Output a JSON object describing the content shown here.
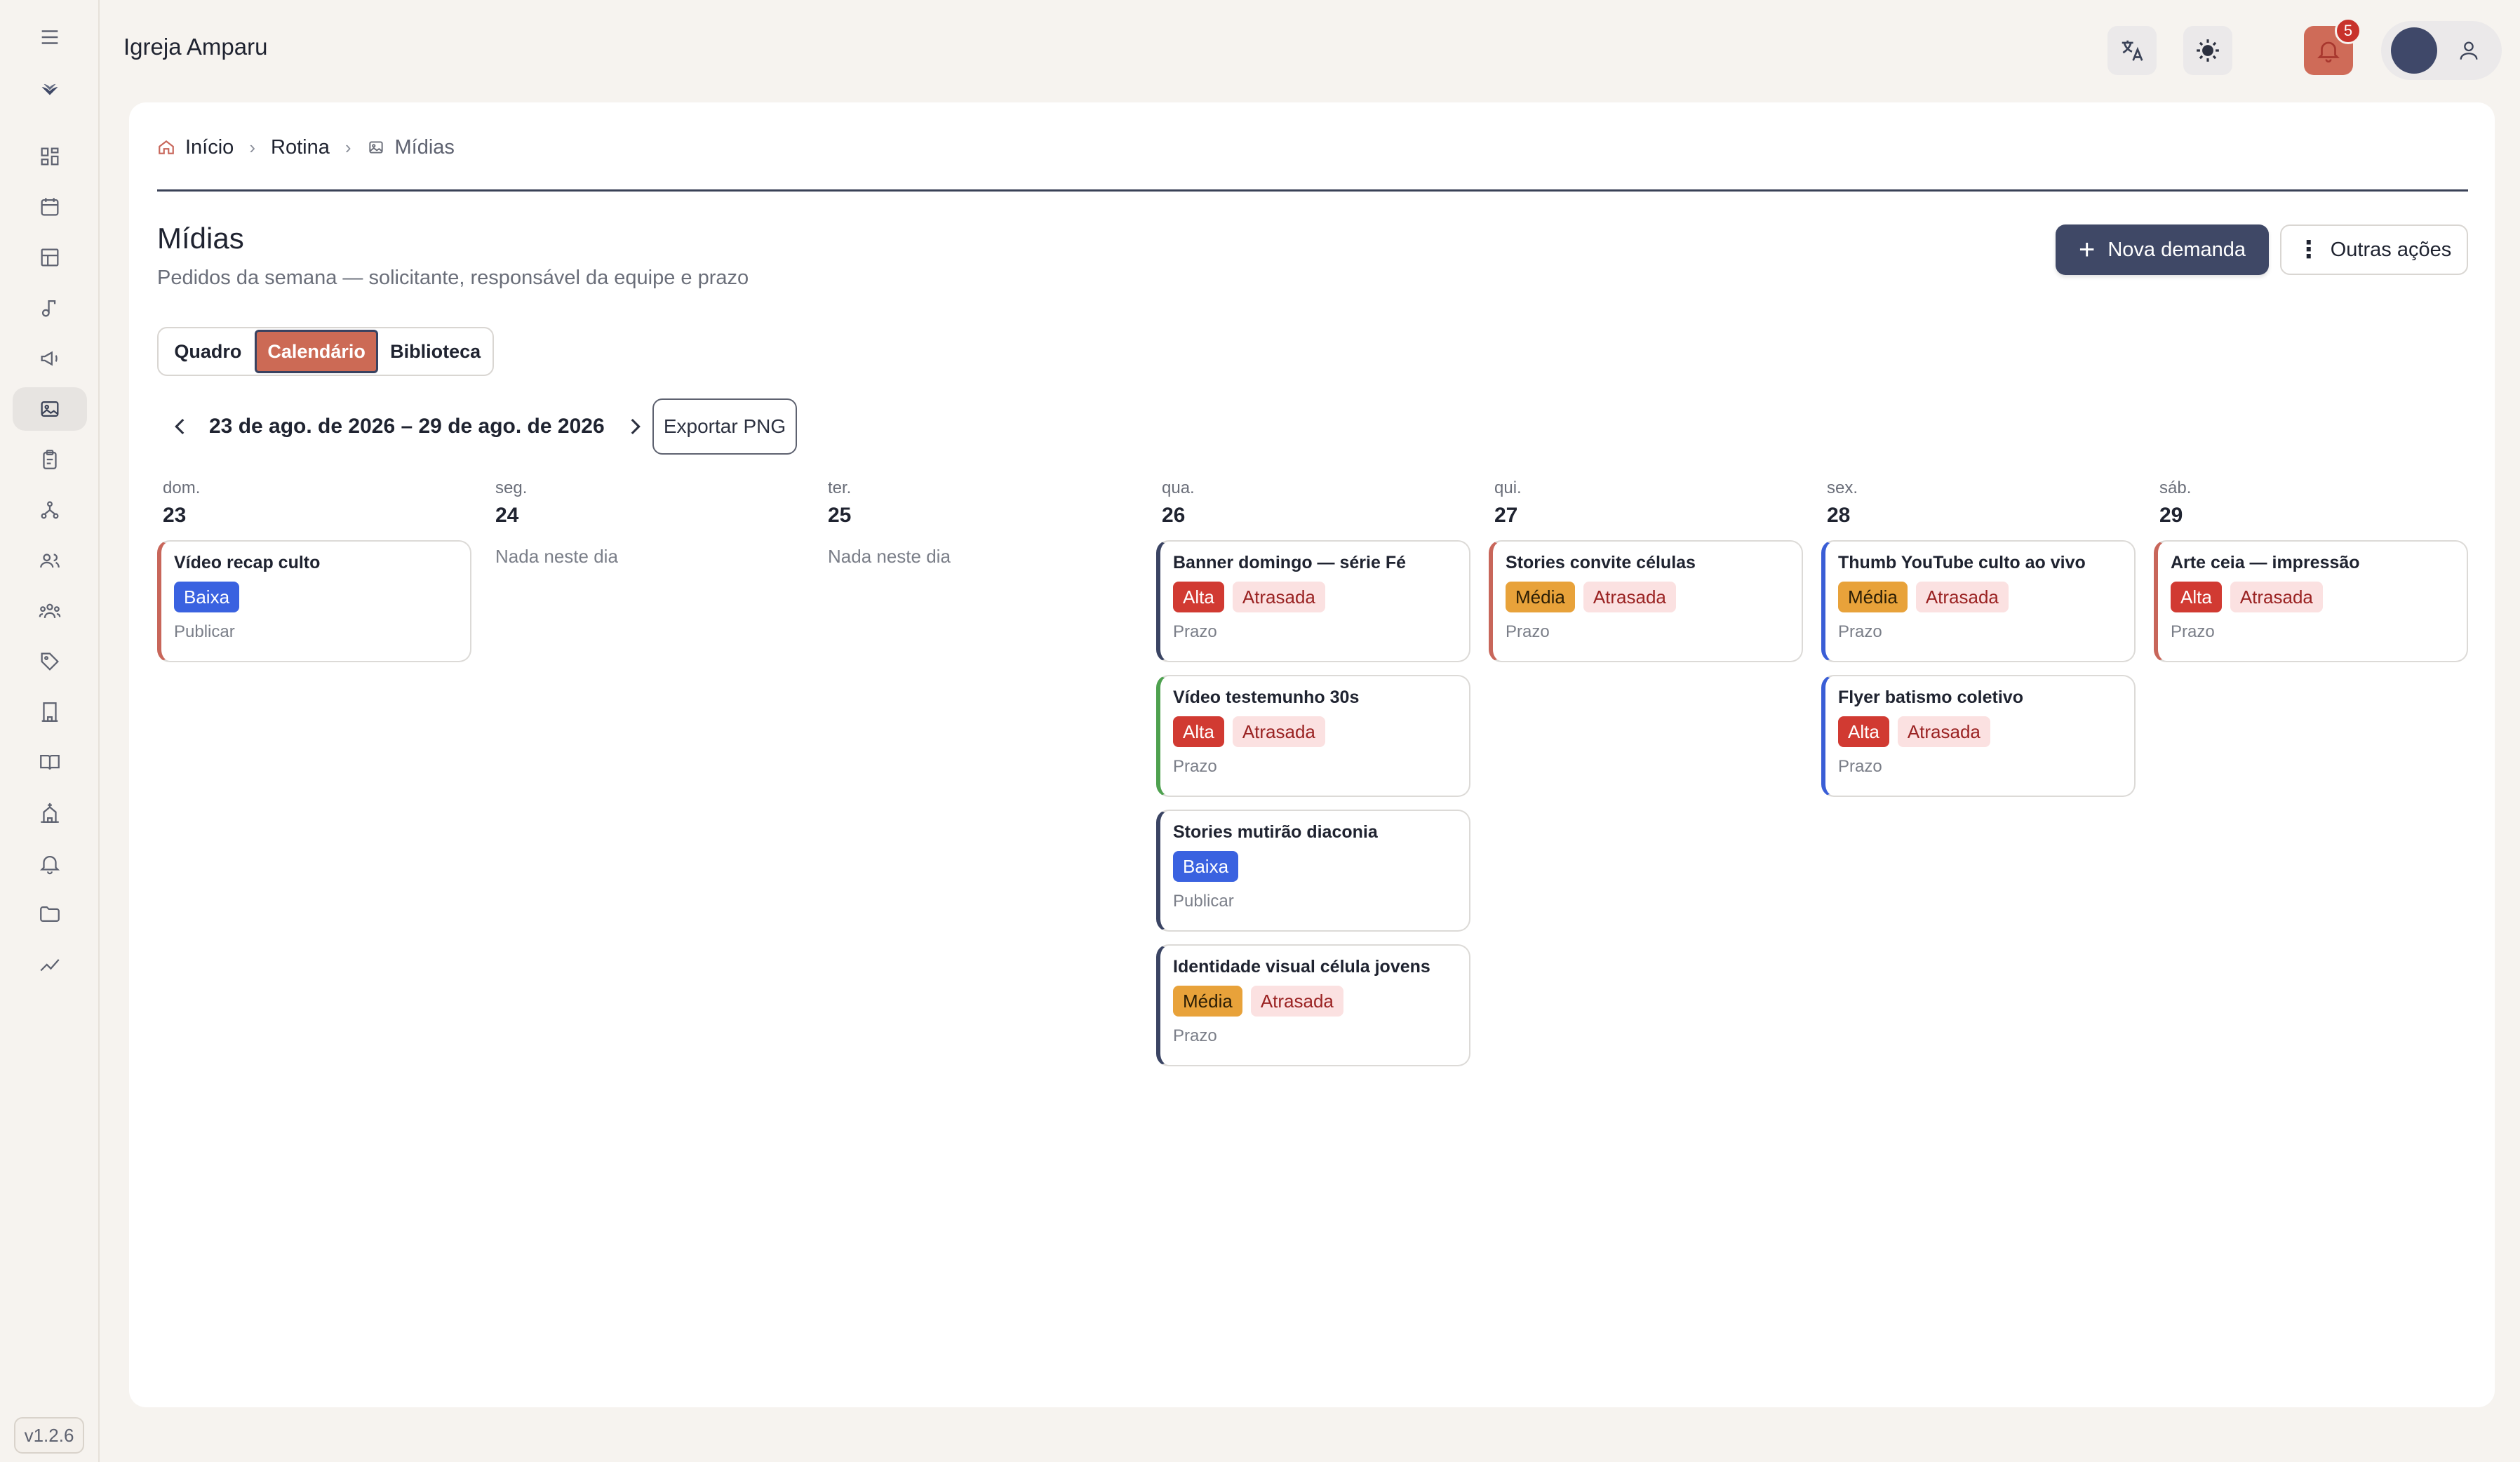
{
  "app": {
    "org_name": "Igreja Amparu",
    "version": "v1.2.6",
    "notifications_count": "5"
  },
  "colors": {
    "accent": "#cc6a55",
    "primary": "#3f4866",
    "priority_alta": "#d13a32",
    "priority_media": "#e8a23a",
    "priority_baixa": "#3a62e0",
    "late_bg": "#fbe1e1",
    "late_text": "#9a2222"
  },
  "sidebar": {
    "items": [
      {
        "icon": "menu-icon"
      },
      {
        "icon": "logo-icon"
      },
      {
        "icon": "dashboard-icon"
      },
      {
        "icon": "calendar-icon"
      },
      {
        "icon": "table-icon"
      },
      {
        "icon": "music-icon"
      },
      {
        "icon": "megaphone-icon"
      },
      {
        "icon": "image-icon",
        "active": true
      },
      {
        "icon": "clipboard-icon"
      },
      {
        "icon": "hierarchy-icon"
      },
      {
        "icon": "users-icon"
      },
      {
        "icon": "group-icon"
      },
      {
        "icon": "tag-icon"
      },
      {
        "icon": "building-icon"
      },
      {
        "icon": "book-icon"
      },
      {
        "icon": "church-icon"
      },
      {
        "icon": "bell-icon"
      },
      {
        "icon": "folder-icon"
      },
      {
        "icon": "trend-icon"
      }
    ]
  },
  "breadcrumb": {
    "home": "Início",
    "routine": "Rotina",
    "current": "Mídias"
  },
  "page": {
    "title": "Mídias",
    "subtitle": "Pedidos da semana — solicitante, responsável da equipe e prazo",
    "new_button": "Nova demanda",
    "more_button": "Outras ações"
  },
  "tabs": [
    {
      "label": "Quadro"
    },
    {
      "label": "Calendário",
      "active": true
    },
    {
      "label": "Biblioteca"
    }
  ],
  "week": {
    "label": "23 de ago. de 2026 – 29 de ago. de 2026",
    "export_button": "Exportar PNG"
  },
  "empty_label": "Nada neste dia",
  "days": [
    {
      "name": "dom.",
      "num": "23",
      "cards": [
        {
          "title": "Vídeo recap culto",
          "priority": "Baixa",
          "late": "",
          "footer": "Publicar",
          "border": "#c8665a"
        }
      ]
    },
    {
      "name": "seg.",
      "num": "24",
      "cards": []
    },
    {
      "name": "ter.",
      "num": "25",
      "cards": []
    },
    {
      "name": "qua.",
      "num": "26",
      "cards": [
        {
          "title": "Banner domingo — série Fé",
          "priority": "Alta",
          "late": "Atrasada",
          "footer": "Prazo",
          "border": "#3a4463"
        },
        {
          "title": "Vídeo testemunho 30s",
          "priority": "Alta",
          "late": "Atrasada",
          "footer": "Prazo",
          "border": "#4ea14f"
        },
        {
          "title": "Stories mutirão diaconia",
          "priority": "Baixa",
          "late": "",
          "footer": "Publicar",
          "border": "#3a4463"
        },
        {
          "title": "Identidade visual célula jovens",
          "priority": "Média",
          "late": "Atrasada",
          "footer": "Prazo",
          "border": "#3a4463"
        }
      ]
    },
    {
      "name": "qui.",
      "num": "27",
      "cards": [
        {
          "title": "Stories convite células",
          "priority": "Média",
          "late": "Atrasada",
          "footer": "Prazo",
          "border": "#c8665a"
        }
      ]
    },
    {
      "name": "sex.",
      "num": "28",
      "cards": [
        {
          "title": "Thumb YouTube culto ao vivo",
          "priority": "Média",
          "late": "Atrasada",
          "footer": "Prazo",
          "border": "#3a5ed6"
        },
        {
          "title": "Flyer batismo coletivo",
          "priority": "Alta",
          "late": "Atrasada",
          "footer": "Prazo",
          "border": "#3a5ed6"
        }
      ]
    },
    {
      "name": "sáb.",
      "num": "29",
      "cards": [
        {
          "title": "Arte ceia — impressão",
          "priority": "Alta",
          "late": "Atrasada",
          "footer": "Prazo",
          "border": "#c8665a"
        }
      ]
    }
  ]
}
